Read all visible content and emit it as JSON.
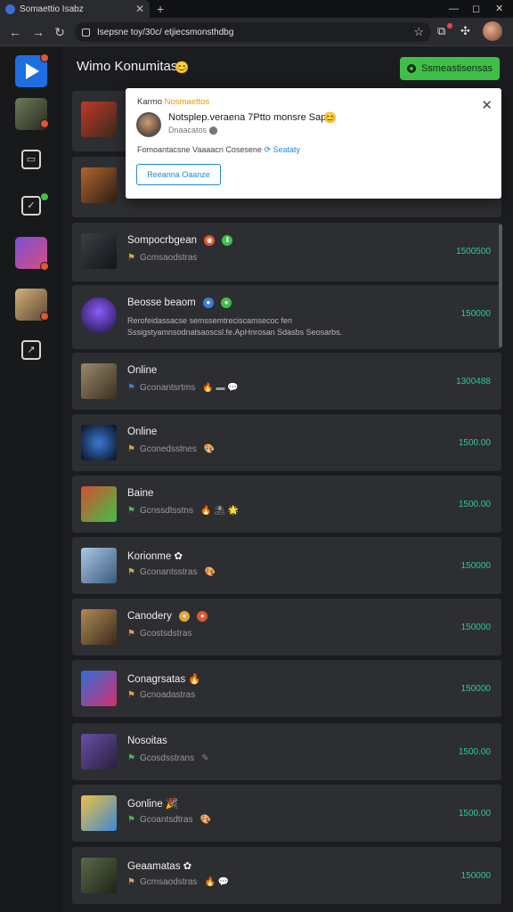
{
  "browser": {
    "tab_title": "Somaettio Isabz",
    "url": "Isepsne toy/30c/ etjiecsmonsthdbg",
    "new_tab_glyph": "+",
    "close_glyph": "✕"
  },
  "app": {
    "page_title": "Wimo Konumitas",
    "title_emoji": "😊",
    "cta_label": "Ssmeastisensas"
  },
  "popup": {
    "header_prefix": "Karmo",
    "header_accent": "Nosmaettos",
    "title": "Notsplep.veraena 7Ptto monsre Sap",
    "title_emoji": "😊",
    "meta": "Dnaacatos ⬤",
    "desc": "Fomoantacsne Vaaaacn Cosesene",
    "link": "Seataty",
    "button_label": "Reeanna Oaanze",
    "close_glyph": "✕"
  },
  "rows": [
    {
      "name": "Sompocrbgean",
      "sub": "Gcmsaodstras",
      "amount": "1500500",
      "badges": [
        "#e0562f",
        "#3fbf4a"
      ],
      "badge_glyphs": [
        "◉",
        "⬇"
      ]
    },
    {
      "name": "Beosse beaom",
      "desc1": "Rerofeidassacse semssemtreciscamsecoc fen",
      "desc2": "Sssigstyamnsodnatsaoscsl.fe.ApHnrosan Sdasbs Seosarbs.",
      "amount": "150000",
      "badges": [
        "#3f7bd6",
        "#3fbf4a"
      ],
      "badge_glyphs": [
        "●",
        "●"
      ]
    },
    {
      "name": "Online",
      "sub": "Gconantsrtms",
      "amount": "1300488",
      "extras": "🔥 ▬ 💬"
    },
    {
      "name": "Online",
      "sub": "Gconedsstnes",
      "amount": "1500.00",
      "extras": "🎨"
    },
    {
      "name": "Baine",
      "sub": "Gcnssdtsstns",
      "amount": "1500.00",
      "extras": "🔥 ⛱ 🌟"
    },
    {
      "name": "Korionme",
      "sub": "Gconantsstras",
      "amount": "150000",
      "name_emoji": "✿",
      "extras": "🎨"
    },
    {
      "name": "Canodery",
      "sub": "Gcostsdstras",
      "amount": "150000",
      "badges": [
        "#e0a82f",
        "#e0562f"
      ],
      "badge_glyphs": [
        "●",
        "●"
      ]
    },
    {
      "name": "Conagrsatas",
      "sub": "Gcnoadastras",
      "amount": "150000",
      "name_emoji": "🔥"
    },
    {
      "name": "Nosoitas",
      "sub": "Gcosdsstrans",
      "amount": "1500.00",
      "extras": "✎"
    },
    {
      "name": "Gonline",
      "sub": "Gcoantsdtras",
      "amount": "1500.00",
      "name_emoji": "🎉",
      "extras": "🎨"
    },
    {
      "name": "Geaamatas",
      "sub": "Gcmsaodstras",
      "amount": "150000",
      "name_emoji": "✿",
      "extras": "🔥 💬"
    }
  ],
  "sidebar_badges": [
    "#e0562f",
    "#e0562f",
    "#3fbf4a",
    "#e0562f",
    "#e0562f"
  ]
}
